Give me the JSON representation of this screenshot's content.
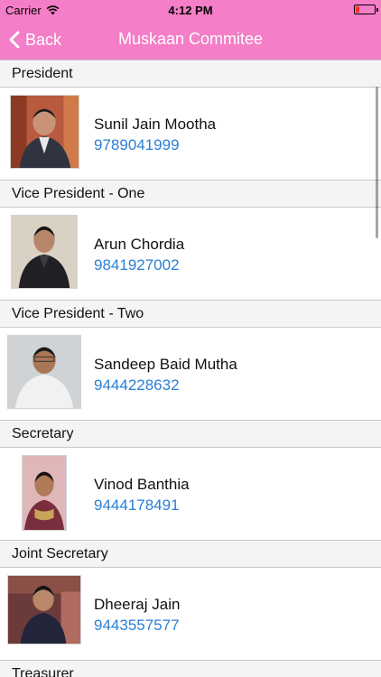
{
  "status_bar": {
    "carrier": "Carrier",
    "time": "4:12 PM"
  },
  "nav": {
    "back_label": "Back",
    "title": "Muskaan Commitee"
  },
  "colors": {
    "nav_bg": "#f47ec7",
    "phone_link": "#2a7fd4",
    "section_bg": "#f4f4f4"
  },
  "sections": [
    {
      "title": "President",
      "name": "Sunil Jain Mootha",
      "phone": "9789041999"
    },
    {
      "title": "Vice President - One",
      "name": "Arun Chordia",
      "phone": "9841927002"
    },
    {
      "title": "Vice President - Two",
      "name": "Sandeep Baid Mutha",
      "phone": "9444228632"
    },
    {
      "title": "Secretary",
      "name": "Vinod Banthia",
      "phone": "9444178491"
    },
    {
      "title": "Joint Secretary",
      "name": "Dheeraj Jain",
      "phone": "9443557577"
    },
    {
      "title": "Treasurer"
    }
  ]
}
